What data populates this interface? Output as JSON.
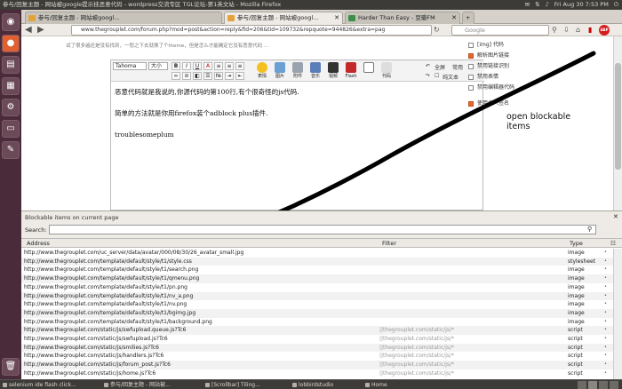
{
  "window": {
    "title": "参与/回复主题 - 网站被google提示挂恶意代码 - wordpress交流专区 TGL论坛-第1英文站 - Mozilla Firefox",
    "clock": "Fri Aug 30  7:53 PM"
  },
  "tabs": [
    {
      "label": "参与/回复主题 - 网站被googl..."
    },
    {
      "label": "Harder Than Easy - 豆瓣FM"
    }
  ],
  "nav": {
    "url": "www.thegrouplet.com/forum.php?mod=post&action=reply&fid=206&tid=109732&repquote=944826&extra=pag",
    "search_engine": "Google",
    "search_placeholder": "Google",
    "abp_label": "ABP"
  },
  "page": {
    "hint": "试了很多遍还是没有找到，一怒之下去就换了个theme，但是怎么才能确定它没有恶意代码 ...",
    "toolbar": {
      "font": "Tahoma",
      "size": "大小",
      "emoji": "表情",
      "image": "图片",
      "attach": "附件",
      "music": "音乐",
      "video": "视频",
      "flash": "Flash",
      "code": "代码",
      "fullscreen": "全屏",
      "normal": "常用",
      "plaintext": "纯文本"
    },
    "editor_lines": [
      "恶意代码就是我说的,你源代码的第100行,有个很奇怪的js代码.",
      "简单的方法就是你用firefox装个adblock plus插件.",
      "troublesomeplum"
    ],
    "side_options": [
      {
        "label": "[img] 代码",
        "checked": false,
        "partial": true
      },
      {
        "label": "解析图片链接",
        "checked": true
      },
      {
        "label": "禁用链接识别",
        "checked": false
      },
      {
        "label": "禁用表情",
        "checked": false
      },
      {
        "label": "禁用编辑器代码",
        "checked": false
      },
      {
        "label": "使用个人签名",
        "checked": true
      }
    ],
    "annotation": "open blockable\nitems"
  },
  "blockable": {
    "title": "Blockable items on current page",
    "search_label": "Search:",
    "search_value": "",
    "columns": [
      "Address",
      "Filter",
      "Type"
    ],
    "rows": [
      {
        "address": "http://www.thegrouplet.com/uc_server/data/avatar/000/08/30/26_avatar_small.jpg",
        "filter": "",
        "type": "image"
      },
      {
        "address": "http://www.thegrouplet.com/template/default/style/t1/style.css",
        "filter": "",
        "type": "stylesheet"
      },
      {
        "address": "http://www.thegrouplet.com/template/default/style/t1/search.png",
        "filter": "",
        "type": "image"
      },
      {
        "address": "http://www.thegrouplet.com/template/default/style/t1/qmenu.png",
        "filter": "",
        "type": "image"
      },
      {
        "address": "http://www.thegrouplet.com/template/default/style/t1/pn.png",
        "filter": "",
        "type": "image"
      },
      {
        "address": "http://www.thegrouplet.com/template/default/style/t1/nv_a.png",
        "filter": "",
        "type": "image"
      },
      {
        "address": "http://www.thegrouplet.com/template/default/style/t1/nv.png",
        "filter": "",
        "type": "image"
      },
      {
        "address": "http://www.thegrouplet.com/template/default/style/t1/bgimg.jpg",
        "filter": "",
        "type": "image"
      },
      {
        "address": "http://www.thegrouplet.com/template/default/style/t1/background.png",
        "filter": "",
        "type": "image"
      },
      {
        "address": "http://www.thegrouplet.com/static/js/swfupload.queue.js?Tc6",
        "filter": "||thegrouplet.com/static/js/*",
        "type": "script"
      },
      {
        "address": "http://www.thegrouplet.com/static/js/swfupload.js?Tc6",
        "filter": "||thegrouplet.com/static/js/*",
        "type": "script"
      },
      {
        "address": "http://www.thegrouplet.com/static/js/smilies.js?Tc6",
        "filter": "||thegrouplet.com/static/js/*",
        "type": "script"
      },
      {
        "address": "http://www.thegrouplet.com/static/js/handlers.js?Tc6",
        "filter": "||thegrouplet.com/static/js/*",
        "type": "script"
      },
      {
        "address": "http://www.thegrouplet.com/static/js/forum_post.js?Tc6",
        "filter": "||thegrouplet.com/static/js/*",
        "type": "script"
      },
      {
        "address": "http://www.thegrouplet.com/static/js/home.js?Tc6",
        "filter": "||thegrouplet.com/static/js/*",
        "type": "script"
      }
    ]
  },
  "taskbar": [
    {
      "label": "selenium ide flash click..."
    },
    {
      "label": "参与/回复主题 - 网站被..."
    },
    {
      "label": "[Scrollbar] Tiling..."
    },
    {
      "label": "lobbirdstudio"
    },
    {
      "label": "Home"
    }
  ]
}
